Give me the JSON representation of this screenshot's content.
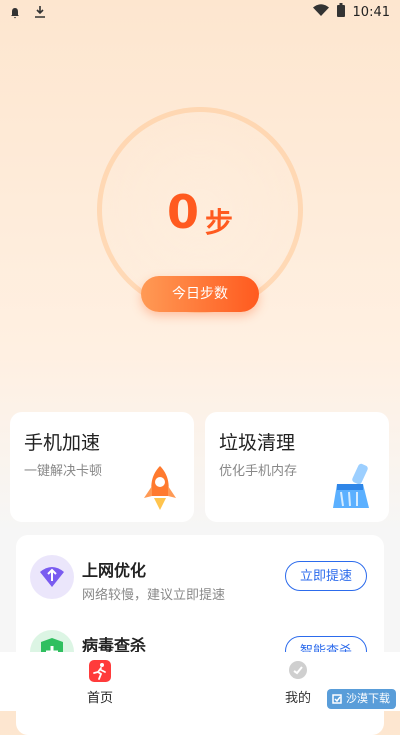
{
  "statusbar": {
    "time": "10:41"
  },
  "steps": {
    "count": "0",
    "unit": "步",
    "button": "今日步数"
  },
  "cards": [
    {
      "title": "手机加速",
      "subtitle": "一键解决卡顿"
    },
    {
      "title": "垃圾清理",
      "subtitle": "优化手机内存"
    }
  ],
  "rows": [
    {
      "title": "上网优化",
      "subtitle": "网络较慢，建议立即提速",
      "action": "立即提速"
    },
    {
      "title": "病毒查杀",
      "subtitle": "",
      "action": "智能查杀"
    }
  ],
  "tabs": [
    {
      "label": "首页"
    },
    {
      "label": "我的"
    }
  ],
  "watermark": "沙漠下载",
  "colors": {
    "accent": "#ff5a1f",
    "blue": "#2c6bec"
  }
}
